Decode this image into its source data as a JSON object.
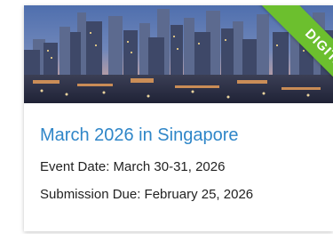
{
  "event_card": {
    "badge": "DIGITAL",
    "title": "March 2026 in Singapore",
    "event_date": "Event Date: March 30-31, 2026",
    "submission_due": "Submission Due: February 25, 2026"
  },
  "colors": {
    "title": "#2f86c8",
    "badge": "#6cbf2e",
    "text": "#222222"
  }
}
